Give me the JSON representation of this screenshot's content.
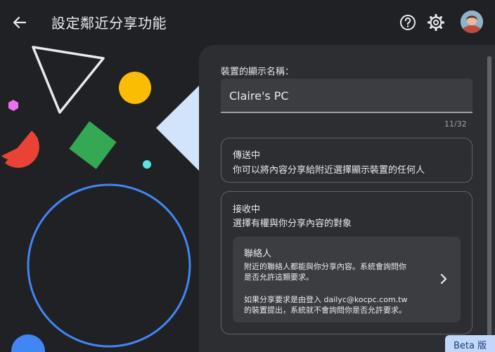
{
  "header": {
    "title": "設定鄰近分享功能",
    "icons": [
      "back-arrow-icon",
      "help-icon",
      "settings-gear-icon",
      "avatar"
    ]
  },
  "device_name": {
    "label": "裝置的顯示名稱：",
    "value": "Claire's PC",
    "counter": "11/32"
  },
  "sending": {
    "title": "傳送中",
    "description": "你可以將內容分享給附近選擇顯示裝置的任何人"
  },
  "receiving": {
    "title": "接收中",
    "description": "選擇有權與你分享內容的對象",
    "contacts": {
      "title": "聯絡人",
      "line1": "附近的聯絡人都能與你分享內容。系統會詢問你",
      "line2": "是否允許這類要求。",
      "line3": "如果分享要求是由登入 dailyc@kocpc.com.tw",
      "line4": "的裝置提出，系統就不會詢問你是否允許要求。"
    }
  },
  "beta_badge": "Beta 版",
  "colors": {
    "background": "#202124",
    "panel": "#2d2e31",
    "accent_blue": "#4285f4",
    "yellow": "#fbbc04",
    "green": "#34a853",
    "red": "#ea4335"
  }
}
